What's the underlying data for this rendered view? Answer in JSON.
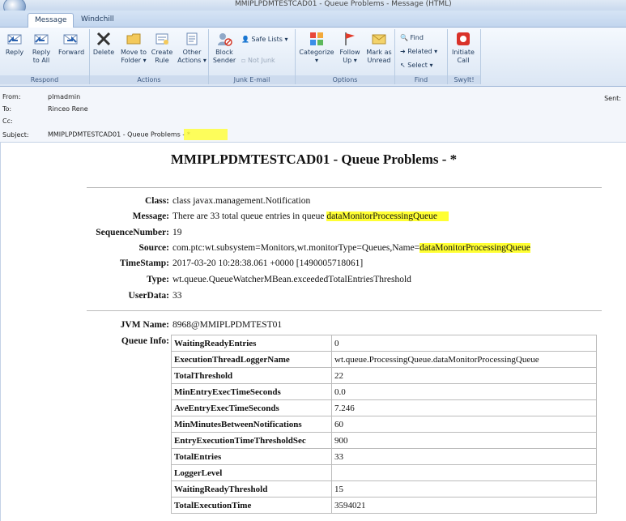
{
  "window": {
    "title": "MMIPLPDMTESTCAD01 - Queue Problems - Message (HTML)"
  },
  "tabs": [
    "Message",
    "Windchill"
  ],
  "ribbon": {
    "respond": {
      "label": "Respond",
      "reply": "Reply",
      "reply_all_1": "Reply",
      "reply_all_2": "to All",
      "forward": "Forward"
    },
    "actions": {
      "label": "Actions",
      "delete": "Delete",
      "move_1": "Move to",
      "move_2": "Folder ▾",
      "create_1": "Create",
      "create_2": "Rule",
      "other_1": "Other",
      "other_2": "Actions ▾"
    },
    "junk": {
      "label": "Junk E-mail",
      "block_1": "Block",
      "block_2": "Sender",
      "safe_lists": "Safe Lists ▾",
      "not_junk": "Not Junk"
    },
    "options": {
      "label": "Options",
      "categorize_1": "Categorize",
      "categorize_2": "▾",
      "follow_1": "Follow",
      "follow_2": "Up ▾",
      "mark_1": "Mark as",
      "mark_2": "Unread"
    },
    "find": {
      "label": "Find",
      "find": "Find",
      "related": "Related ▾",
      "select": "Select ▾"
    },
    "swyit": {
      "label": "SwyIt!",
      "initiate_1": "Initiate",
      "initiate_2": "Call"
    }
  },
  "header": {
    "from_label": "From:",
    "from": "plmadmin",
    "to_label": "To:",
    "to": "Rinceo Rene",
    "cc_label": "Cc:",
    "subject_label": "Subject:",
    "subject": "MMIPLPDMTESTCAD01 - Queue Problems - *",
    "sent_label": "Sent:"
  },
  "message": {
    "title": "MMIPLPDMTESTCAD01 - Queue Problems - *",
    "class_label": "Class:",
    "class": "class javax.management.Notification",
    "message_label": "Message:",
    "message_prefix": "There are 33 total queue entries in queue ",
    "message_queue": "dataMonitorProcessingQueue",
    "seq_label": "SequenceNumber:",
    "seq": "19",
    "source_label": "Source:",
    "source_prefix": "com.ptc:wt.subsystem=Monitors,wt.monitorType=Queues,Name=",
    "source_queue": "dataMonitorProcessingQueue",
    "timestamp_label": "TimeStamp:",
    "timestamp": "2017-03-20 10:28:38.061 +0000 [1490005718061]",
    "type_label": "Type:",
    "type": "wt.queue.QueueWatcherMBean.exceededTotalEntriesThreshold",
    "userdata_label": "UserData:",
    "userdata": "33",
    "jvm_label": "JVM Name:",
    "jvm": "8968@MMIPLPDMTEST01",
    "queue_info_label": "Queue Info:"
  },
  "queue_info": [
    {
      "name": "WaitingReadyEntries",
      "value": "0"
    },
    {
      "name": "ExecutionThreadLoggerName",
      "value": "wt.queue.ProcessingQueue.dataMonitorProcessingQueue"
    },
    {
      "name": "TotalThreshold",
      "value": "22"
    },
    {
      "name": "MinEntryExecTimeSeconds",
      "value": "0.0"
    },
    {
      "name": "AveEntryExecTimeSeconds",
      "value": "7.246"
    },
    {
      "name": "MinMinutesBetweenNotifications",
      "value": "60"
    },
    {
      "name": "EntryExecutionTimeThresholdSec",
      "value": "900"
    },
    {
      "name": "TotalEntries",
      "value": "33"
    },
    {
      "name": "LoggerLevel",
      "value": ""
    },
    {
      "name": "WaitingReadyThreshold",
      "value": "15"
    },
    {
      "name": "TotalExecutionTime",
      "value": "3594021"
    }
  ],
  "colors": {
    "highlight": "#ffff33",
    "ribbon_blue": "#dbe6f4"
  }
}
